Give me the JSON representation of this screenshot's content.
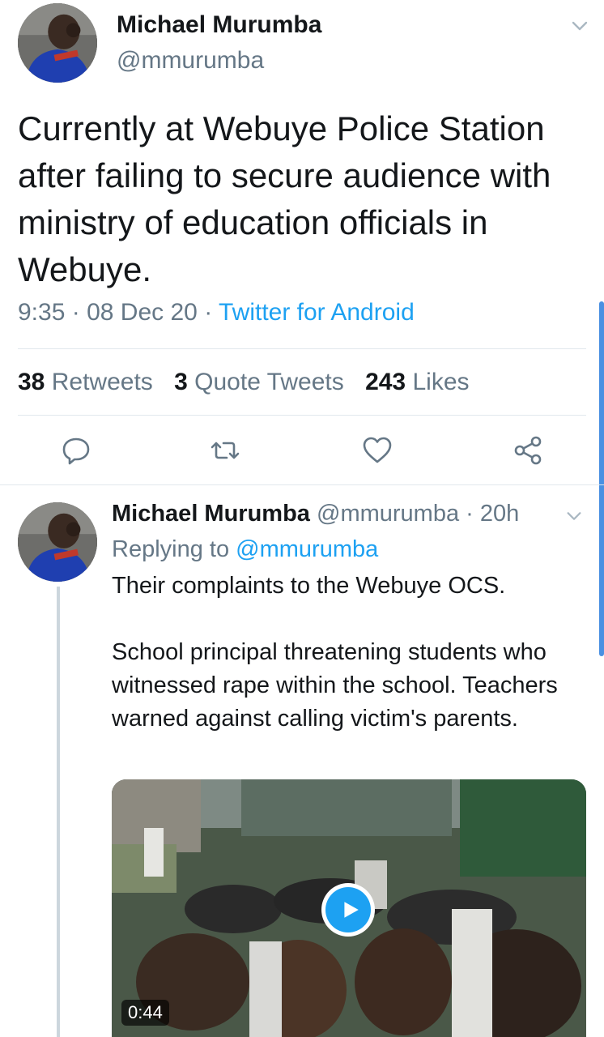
{
  "main_tweet": {
    "author_name": "Michael Murumba",
    "author_handle": "@mmurumba",
    "text": "Currently at Webuye Police Station after failing to secure audience with ministry of education officials in Webuye.",
    "time": "9:35",
    "date": "08 Dec 20",
    "source": "Twitter for Android",
    "separator": "·",
    "retweets_count": "38",
    "retweets_label": "Retweets",
    "quotes_count": "3",
    "quotes_label": "Quote Tweets",
    "likes_count": "243",
    "likes_label": "Likes"
  },
  "reply_tweet": {
    "author_name": "Michael Murumba",
    "author_handle": "@mmurumba",
    "age": "20h",
    "replying_prefix": "Replying to",
    "replying_handle": "@mmurumba",
    "paragraph_1": "Their complaints to the Webuye OCS.",
    "paragraph_2": "School principal threatening students who witnessed rape within the school. Teachers warned against calling victim's parents.",
    "video_duration": "0:44"
  },
  "icons": {
    "reply": "reply-icon",
    "retweet": "retweet-icon",
    "like": "heart-icon",
    "share": "share-icon",
    "chevron": "chevron-down-icon",
    "play": "play-icon"
  },
  "colors": {
    "accent": "#1da1f2",
    "secondary_text": "#657786",
    "primary_text": "#14171a",
    "divider": "#e1e8ed"
  }
}
